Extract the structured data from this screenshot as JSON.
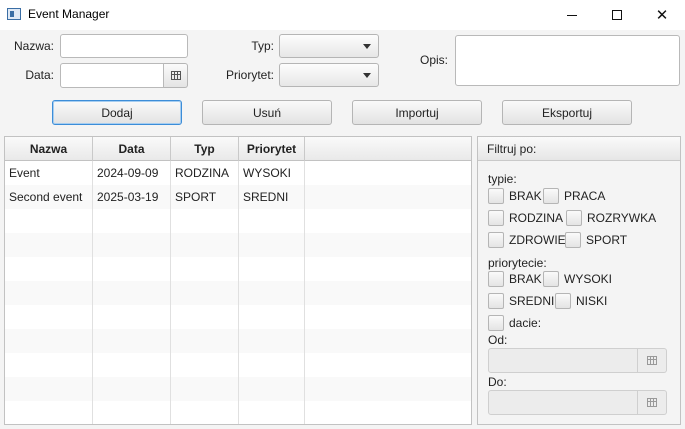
{
  "window": {
    "title": "Event Manager",
    "controls": {
      "minimize_icon": "minimize-icon",
      "maximize_icon": "maximize-icon",
      "close_icon": "close-icon",
      "close_glyph": "✕",
      "minimize_glyph": "—"
    }
  },
  "form": {
    "name_label": "Nazwa:",
    "name_value": "",
    "date_label": "Data:",
    "date_value": "",
    "type_label": "Typ:",
    "type_value": "",
    "priority_label": "Priorytet:",
    "priority_value": "",
    "description_label": "Opis:",
    "description_value": ""
  },
  "actions": {
    "add": "Dodaj",
    "delete": "Usuń",
    "import": "Importuj",
    "export": "Eksportuj"
  },
  "table": {
    "columns": [
      "Nazwa",
      "Data",
      "Typ",
      "Priorytet",
      ""
    ],
    "rows": [
      [
        "Event",
        "2024-09-09",
        "RODZINA",
        "WYSOKI",
        ""
      ],
      [
        "Second event",
        "2025-03-19",
        "SPORT",
        "SREDNI",
        ""
      ]
    ]
  },
  "filter": {
    "title": "Filtruj po:",
    "by_type_label": "typie:",
    "types": [
      "BRAK",
      "PRACA",
      "RODZINA",
      "ROZRYWKA",
      "ZDROWIE",
      "SPORT"
    ],
    "by_priority_label": "priorytecie:",
    "priorities": [
      "BRAK",
      "WYSOKI",
      "SREDNI",
      "NISKI"
    ],
    "by_date_label": "dacie:",
    "from_label": "Od:",
    "from_value": "",
    "to_label": "Do:",
    "to_value": ""
  },
  "colors": {
    "focus_border": "#3c8dd8",
    "panel_bg": "#f4f4f4"
  }
}
